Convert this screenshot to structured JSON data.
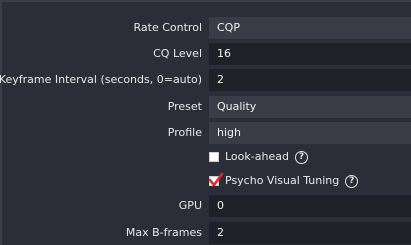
{
  "settings": {
    "rate_control": {
      "label": "Rate Control",
      "value": "CQP"
    },
    "cq_level": {
      "label": "CQ Level",
      "value": "16"
    },
    "keyframe_interval": {
      "label": "Keyframe Interval (seconds, 0=auto)",
      "value": "2"
    },
    "preset": {
      "label": "Preset",
      "value": "Quality"
    },
    "profile": {
      "label": "Profile",
      "value": "high"
    },
    "look_ahead": {
      "label": "Look-ahead",
      "checked": false,
      "help_icon": "?"
    },
    "psycho_visual_tuning": {
      "label": "Psycho Visual Tuning",
      "checked": true,
      "help_icon": "?"
    },
    "gpu": {
      "label": "GPU",
      "value": "0"
    },
    "max_bframes": {
      "label": "Max B-frames",
      "value": "2"
    }
  },
  "colors": {
    "background": "#2b2e38",
    "input_background": "#1f2128",
    "select_background": "#3a3d47",
    "check_accent": "#e0282e"
  }
}
